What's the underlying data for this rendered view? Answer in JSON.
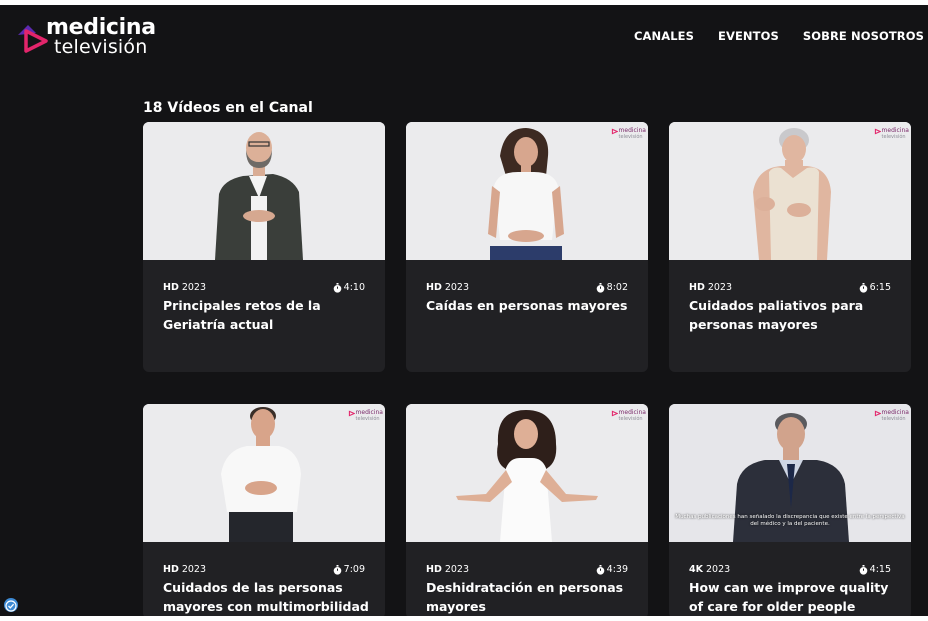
{
  "logo": {
    "line1": "medicina",
    "line2": "televisión"
  },
  "nav": [
    "CANALES",
    "EVENTOS",
    "SOBRE NOSOTROS"
  ],
  "channel": {
    "count_title": "18 Vídeos en el Canal"
  },
  "watermark": {
    "line1": "medicina",
    "line2": "televisión"
  },
  "videos": [
    {
      "quality": "HD",
      "year": "2023",
      "duration": "4:10",
      "title": "Principales retos de la Geriatría actual"
    },
    {
      "quality": "HD",
      "year": "2023",
      "duration": "8:02",
      "title": "Caídas en personas mayores"
    },
    {
      "quality": "HD",
      "year": "2023",
      "duration": "6:15",
      "title": "Cuidados paliativos para personas mayores"
    },
    {
      "quality": "HD",
      "year": "2023",
      "duration": "7:09",
      "title": "Cuidados de las personas mayores con multimorbilidad"
    },
    {
      "quality": "HD",
      "year": "2023",
      "duration": "4:39",
      "title": "Deshidratación en personas mayores"
    },
    {
      "quality": "4K",
      "year": "2023",
      "duration": "4:15",
      "title": "How can we improve quality of care for older people",
      "subtitle": "Muchas publicaciones han señalado la discrepancia que existe entre la perspectiva del médico y la del paciente."
    }
  ],
  "colors": {
    "background": "#131315",
    "card": "#212124",
    "accent_pink": "#e3256b",
    "accent_purple": "#5b2ab0"
  }
}
